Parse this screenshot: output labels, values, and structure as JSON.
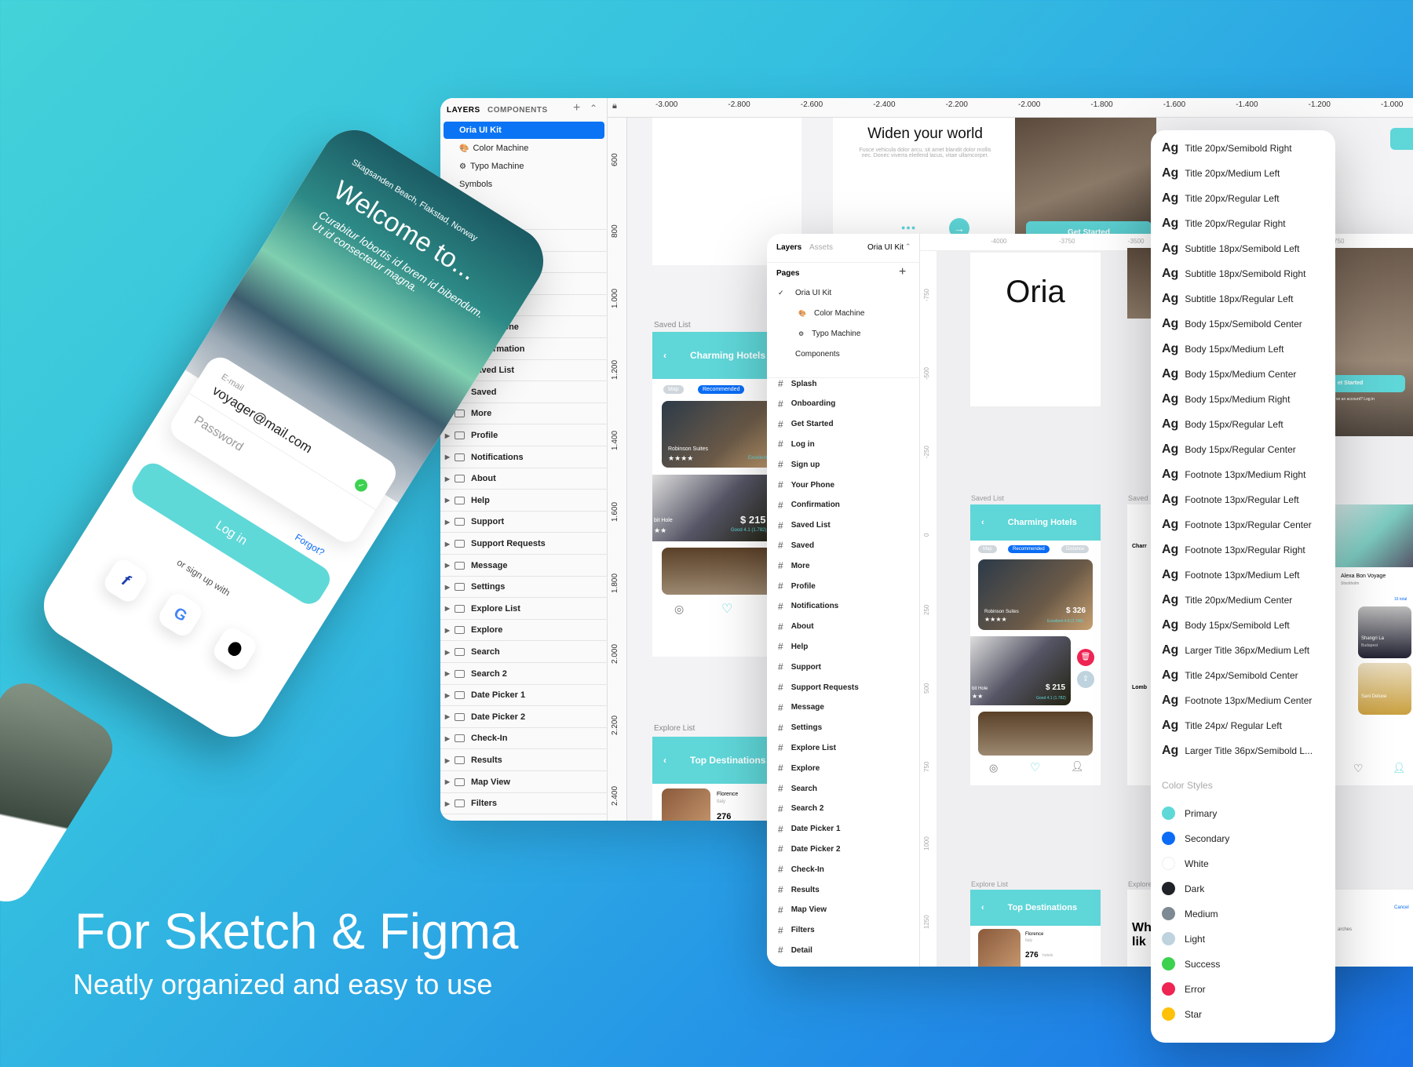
{
  "marketing": {
    "headline": "For Sketch & Figma",
    "subheadline": "Neatly organized and easy to use"
  },
  "sketch": {
    "tabs": [
      "LAYERS",
      "COMPONENTS"
    ],
    "top_items": [
      {
        "label": "Oria UI Kit",
        "selected": true,
        "icon": ""
      },
      {
        "label": "Color Machine",
        "icon": "palette-icon"
      },
      {
        "label": "Typo Machine",
        "icon": "gear-icon"
      },
      {
        "label": "Symbols",
        "icon": ""
      }
    ],
    "artboards": [
      "Splash",
      "Onboarding",
      "Get Started",
      "Log in",
      "Sign up",
      "Your Phone",
      "Confirmation",
      "Saved List",
      "Saved",
      "More",
      "Profile",
      "Notifications",
      "About",
      "Help",
      "Support",
      "Support Requests",
      "Message",
      "Settings",
      "Explore List",
      "Explore",
      "Search",
      "Search 2",
      "Date Picker 1",
      "Date Picker 2",
      "Check-In",
      "Results",
      "Map View",
      "Filters"
    ],
    "ruler_x": [
      "-3.000",
      "-2.800",
      "-2.600",
      "-2.400",
      "-2.200",
      "-2.000",
      "-1.800",
      "-1.600",
      "-1.400",
      "-1.200",
      "-1.000"
    ],
    "ruler_y": [
      "600",
      "800",
      "1.000",
      "1.200",
      "1.400",
      "1.600",
      "1.800",
      "2.000",
      "2.200",
      "2.400"
    ],
    "onboarding": {
      "title": "Widen your world",
      "body": "Fusce vehicula dolor arcu, sit amet blandit dolor mollis nec. Donec viverra eleifend lacus, vitae ullamcorper."
    },
    "get_started": "Get Started",
    "saved_label": "Saved List",
    "saved_header": "Charming Hotels",
    "chip_map": "Map",
    "chip_rec": "Recommended",
    "hotel1": "Robinson Suites",
    "stars1": "★★★★",
    "rating1": "Excellent 4",
    "hotel2": "bit Hole",
    "stars2": "★★",
    "price2": "$ 215",
    "rating2": "Good 4.1 (1.782)",
    "explore_label": "Explore List",
    "explore_header": "Top Destinations",
    "dest": "Florence",
    "dest_country": "Italy",
    "dest_count": "276"
  },
  "figma": {
    "tabs": {
      "layers": "Layers",
      "assets": "Assets",
      "file": "Oria UI Kit"
    },
    "pages_label": "Pages",
    "pages": [
      {
        "label": "Oria UI Kit",
        "checked": true
      },
      {
        "label": "Color Machine",
        "icon": "palette-icon"
      },
      {
        "label": "Typo Machine",
        "icon": "gear-icon"
      },
      {
        "label": "Components"
      }
    ],
    "frames": [
      "Splash",
      "Onboarding",
      "Get Started",
      "Log in",
      "Sign up",
      "Your Phone",
      "Confirmation",
      "Saved List",
      "Saved",
      "More",
      "Profile",
      "Notifications",
      "About",
      "Help",
      "Support",
      "Support Requests",
      "Message",
      "Settings",
      "Explore List",
      "Explore",
      "Search",
      "Search 2",
      "Date Picker 1",
      "Date Picker 2",
      "Check-In",
      "Results",
      "Map View",
      "Filters",
      "Detail"
    ],
    "ruler_x": [
      "-4000",
      "-3750",
      "-3500",
      "-2750"
    ],
    "ruler_y": [
      "-750",
      "-500",
      "-250",
      "0",
      "250",
      "500",
      "750",
      "1000",
      "1250"
    ],
    "logo": "Oria",
    "saved_label": "Saved List",
    "saved_header": "Charming Hotels",
    "chip_map": "Map",
    "chip_rec": "Recommended",
    "chip_dist": "Distance",
    "hotel1": "Robinson Suites",
    "stars1": "★★★★",
    "price1": "$ 326",
    "rating1": "Excellent 4.8 (2.749)",
    "hotel2": "bit Hole",
    "stars2": "★★",
    "price2": "$ 215",
    "rating2": "Good 4.1 (1.782)",
    "explore_label": "Explore List",
    "explore_header": "Top Destinations",
    "dest": "Florence",
    "dest_country": "Italy",
    "dest_count": "276",
    "dest_unit": "hotels",
    "side_label": "Saved",
    "side_label2": "Explore",
    "side_c1": "Charr",
    "side_c2": "Lomb",
    "side_text": "Wh lik",
    "far_card": "Alexa Bon Voyage",
    "far_city": "Stockholm",
    "far_total": "16 total",
    "far_h1": "Shangri La",
    "far_h1_city": "Budapest",
    "far_h2": "Sani Deluxe",
    "far_cancel": "Cancel",
    "far_searches": "arches",
    "far_gs": "et Started",
    "far_account": "ve an account?  Log in"
  },
  "styles": {
    "text_styles": [
      "Title 20px/Semibold Right",
      "Title 20px/Medium Left",
      "Title 20px/Regular Left",
      "Title 20px/Regular Right",
      "Subtitle 18px/Semibold Left",
      "Subtitle 18px/Semibold Right",
      "Subtitle 18px/Regular Left",
      "Body 15px/Semibold Center",
      "Body 15px/Medium Left",
      "Body 15px/Medium Center",
      "Body 15px/Medium Right",
      "Body 15px/Regular Left",
      "Body 15px/Regular Center",
      "Footnote 13px/Medium Right",
      "Footnote 13px/Regular Left",
      "Footnote 13px/Regular Center",
      "Footnote 13px/Regular Right",
      "Footnote 13px/Medium Left",
      "Title 20px/Medium Center",
      "Body 15px/Semibold Left",
      "Larger Title 36px/Medium Left",
      "Title 24px/Semibold Center",
      "Footnote 13px/Medium Center",
      "Title 24px/ Regular Left",
      "Larger Title 36px/Semibold L..."
    ],
    "ag": "Ag",
    "color_heading": "Color Styles",
    "colors": [
      {
        "name": "Primary",
        "hex": "#5fd8d8"
      },
      {
        "name": "Secondary",
        "hex": "#0a6cf5"
      },
      {
        "name": "White",
        "hex": "#ffffff"
      },
      {
        "name": "Dark",
        "hex": "#1f2227"
      },
      {
        "name": "Medium",
        "hex": "#7d8a93"
      },
      {
        "name": "Light",
        "hex": "#bfd3de"
      },
      {
        "name": "Success",
        "hex": "#3cd24f"
      },
      {
        "name": "Error",
        "hex": "#ee2452"
      },
      {
        "name": "Star",
        "hex": "#ffc107"
      }
    ]
  },
  "phone": {
    "location": "Skagsanden Beach, Flakstad, Norway",
    "welcome": "Welcome to...",
    "body": "Curabitur lobortis id lorem id bibendum. Ut id consectetur magna.",
    "email_label": "E-mail",
    "email_value": "voyager@mail.com",
    "password_placeholder": "Password",
    "forgot": "Forgot?",
    "login": "Log in",
    "or_sign": "or sign up with",
    "social": [
      "f",
      "G",
      ""
    ]
  },
  "colors": {
    "primary": "#5fd8d8",
    "secondary": "#0a6cf5"
  }
}
